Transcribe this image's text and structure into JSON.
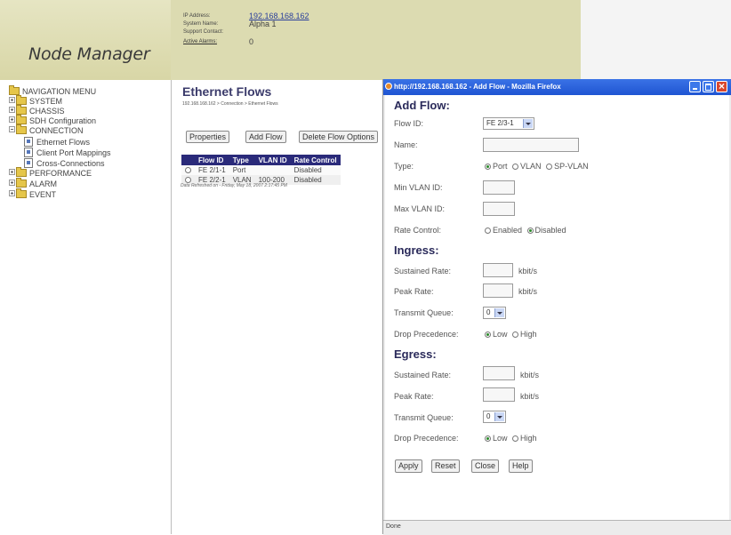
{
  "header": {
    "logo": "Node Manager",
    "info": {
      "ip_label": "IP Address:",
      "ip_value": "192.168.168.162",
      "system_label": "System Name:",
      "system_value": "Alpha 1",
      "support_label": "Support Contact:",
      "support_value": "",
      "alarms_label": "Active Alarms:",
      "alarms_value": "0"
    }
  },
  "nav": {
    "items": [
      {
        "label": "NAVIGATION MENU"
      },
      {
        "label": "SYSTEM"
      },
      {
        "label": "CHASSIS"
      },
      {
        "label": "SDH Configuration"
      },
      {
        "label": "CONNECTION"
      },
      {
        "label": "Ethernet Flows"
      },
      {
        "label": "Client Port Mappings"
      },
      {
        "label": "Cross-Connections"
      },
      {
        "label": "PERFORMANCE"
      },
      {
        "label": "ALARM"
      },
      {
        "label": "EVENT"
      }
    ]
  },
  "main": {
    "title": "Ethernet Flows",
    "breadcrumb": "192.168.168.162 > Connection > Ethernet Flows",
    "buttons": {
      "properties": "Properties",
      "add_flow": "Add Flow",
      "delete": "Delete Flow Options"
    },
    "table": {
      "headers": [
        "Flow ID",
        "Type",
        "VLAN ID",
        "Rate Control"
      ],
      "rows": [
        [
          "FE 2/1-1",
          "Port",
          "",
          "Disabled"
        ],
        [
          "FE 2/2-1",
          "VLAN",
          "100-200",
          "Disabled"
        ]
      ]
    },
    "refreshed": "Data Refreshed on - Friday, May 18, 2007 2:17:45 PM"
  },
  "popup": {
    "title": "http://192.168.168.162 - Add Flow - Mozilla Firefox",
    "heading": "Add Flow:",
    "flow_id_label": "Flow ID:",
    "flow_id_value": "FE 2/3-1",
    "name_label": "Name:",
    "name_value": "",
    "type_label": "Type:",
    "type_options": [
      "Port",
      "VLAN",
      "SP-VLAN"
    ],
    "type_selected": "Port",
    "min_vlan_label": "Min VLAN ID:",
    "max_vlan_label": "Max VLAN ID:",
    "rate_control_label": "Rate Control:",
    "rate_options": [
      "Enabled",
      "Disabled"
    ],
    "rate_selected": "Disabled",
    "ingress": {
      "heading": "Ingress:",
      "sustained_label": "Sustained Rate:",
      "peak_label": "Peak Rate:",
      "unit": "kbit/s",
      "queue_label": "Transmit Queue:",
      "queue_value": "0",
      "drop_label": "Drop Precedence:",
      "drop_options": [
        "Low",
        "High"
      ],
      "drop_selected": "Low"
    },
    "egress": {
      "heading": "Egress:",
      "sustained_label": "Sustained Rate:",
      "peak_label": "Peak Rate:",
      "unit": "kbit/s",
      "queue_label": "Transmit Queue:",
      "queue_value": "0",
      "drop_label": "Drop Precedence:",
      "drop_options": [
        "Low",
        "High"
      ],
      "drop_selected": "Low"
    },
    "buttons": {
      "apply": "Apply",
      "reset": "Reset",
      "close": "Close",
      "help": "Help"
    },
    "status": "Done"
  },
  "colors": {
    "header_bg": "#dcdbb1",
    "table_header": "#2a2a7a",
    "titlebar": "#1f55d2",
    "section_heading": "#2a2a5a"
  },
  "icons": [
    "folder-icon",
    "page-icon",
    "firefox-icon",
    "minimize-icon",
    "maximize-icon",
    "close-icon"
  ]
}
